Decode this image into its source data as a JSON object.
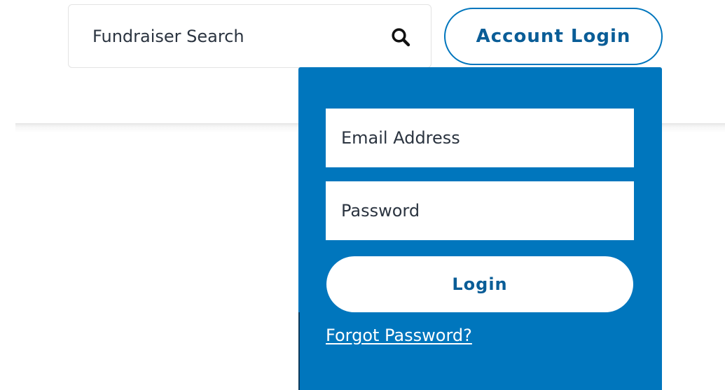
{
  "search": {
    "placeholder": "Fundraiser Search",
    "icon": "search-icon"
  },
  "header": {
    "account_login_label": "Account Login"
  },
  "login_panel": {
    "email_placeholder": "Email Address",
    "password_placeholder": "Password",
    "login_label": "Login",
    "forgot_password_label": "Forgot Password?"
  },
  "colors": {
    "brand_blue": "#0076bd",
    "button_text": "#0a5d97",
    "field_text": "#2b3440",
    "white": "#ffffff"
  }
}
